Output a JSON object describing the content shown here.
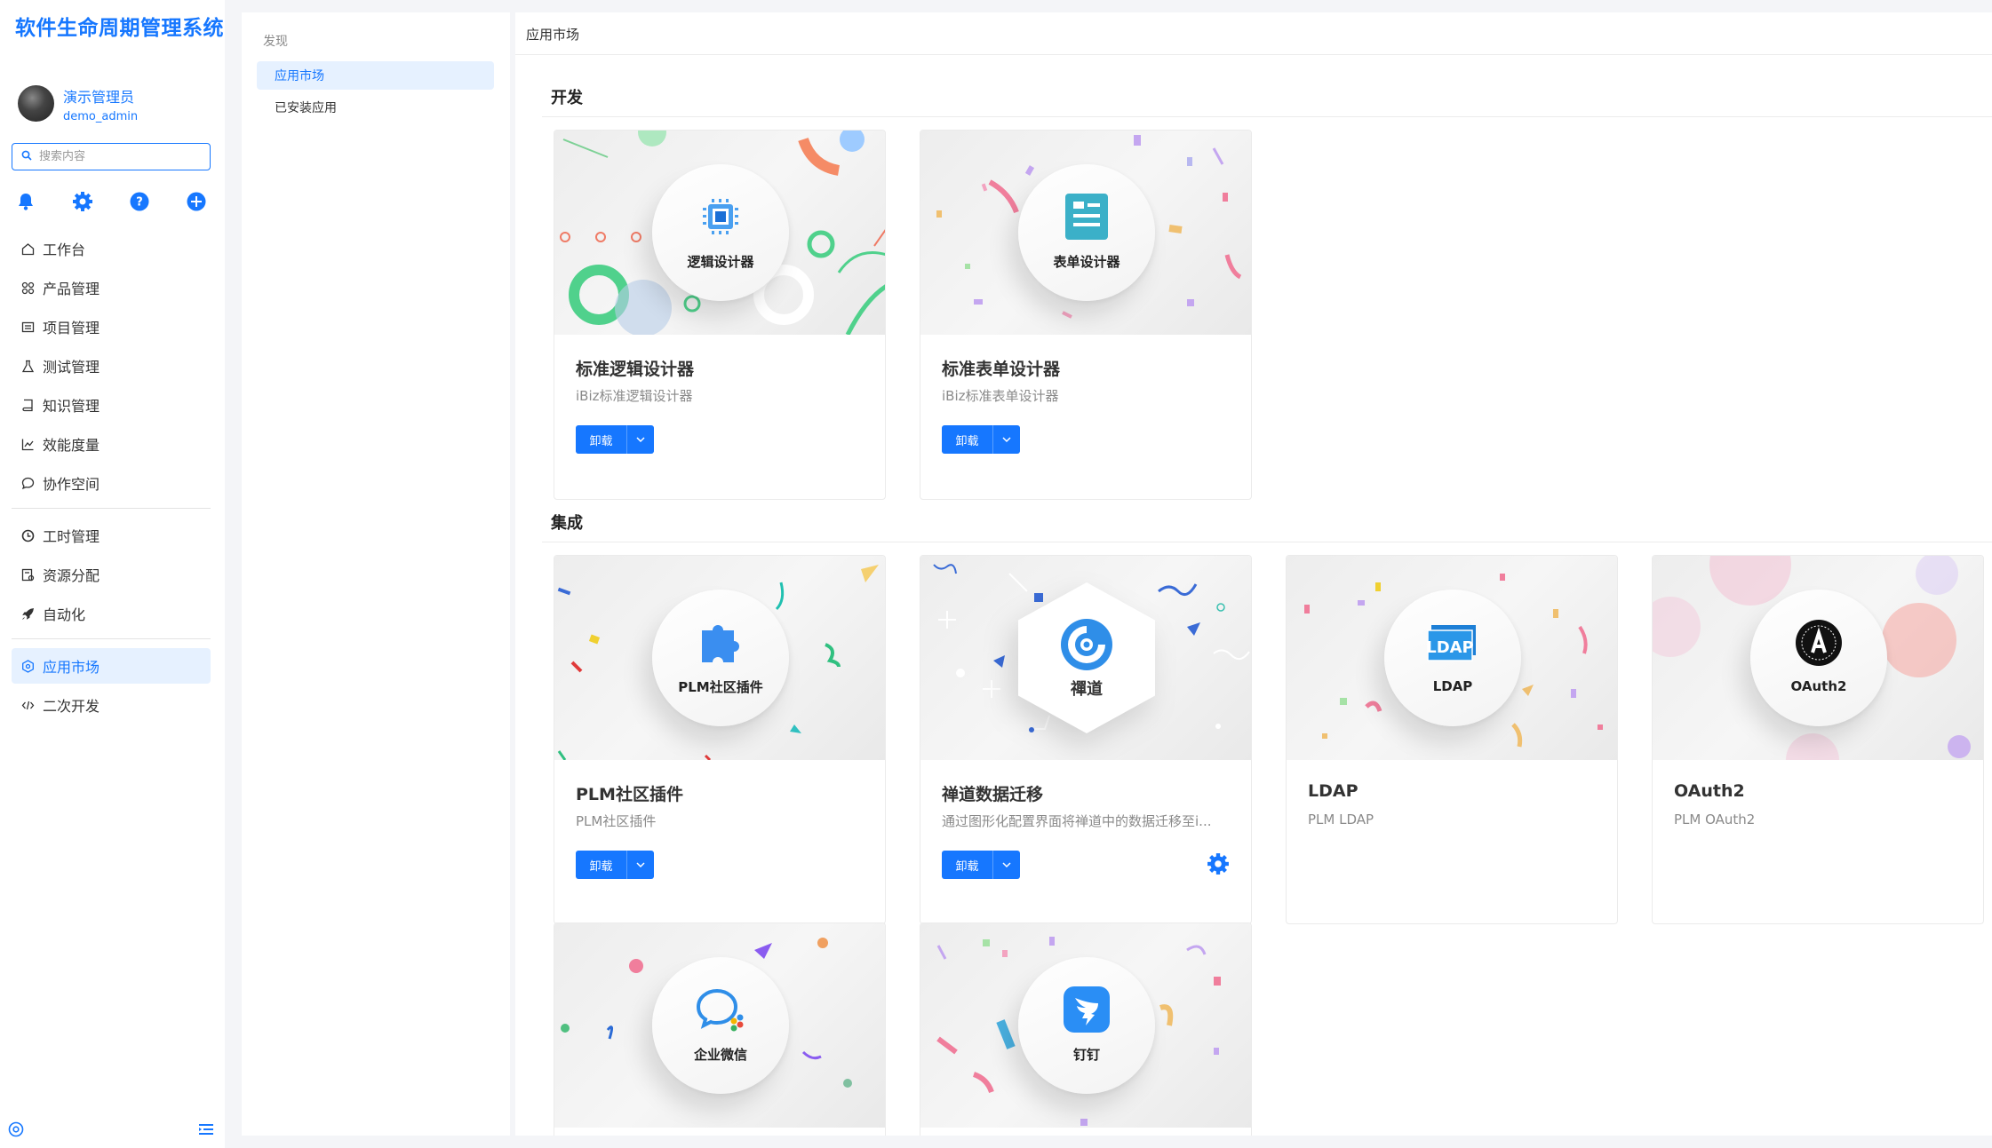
{
  "brand": "软件生命周期管理系统",
  "user": {
    "name": "演示管理员",
    "id": "demo_admin"
  },
  "search": {
    "placeholder": "搜索内容"
  },
  "nav": {
    "workbench": "工作台",
    "product": "产品管理",
    "project": "项目管理",
    "test": "测试管理",
    "knowledge": "知识管理",
    "metrics": "效能度量",
    "collab": "协作空间",
    "worktime": "工时管理",
    "resource": "资源分配",
    "automation": "自动化",
    "market": "应用市场",
    "secondary": "二次开发"
  },
  "panel": {
    "title": "发现",
    "items": [
      "应用市场",
      "已安装应用"
    ]
  },
  "breadcrumb": "应用市场",
  "sections": [
    "开发",
    "集成"
  ],
  "cards": [
    {
      "banner_label": "逻辑设计器",
      "title": "标准逻辑设计器",
      "desc": "iBiz标准逻辑设计器",
      "button": "卸载"
    },
    {
      "banner_label": "表单设计器",
      "title": "标准表单设计器",
      "desc": "iBiz标准表单设计器",
      "button": "卸载"
    },
    {
      "banner_label": "PLM社区插件",
      "title": "PLM社区插件",
      "desc": "PLM社区插件",
      "button": "卸载"
    },
    {
      "banner_label": "禪道",
      "title": "禅道数据迁移",
      "desc": "通过图形化配置界面将禅道中的数据迁移至i...",
      "button": "卸载"
    },
    {
      "banner_label": "LDAP",
      "title": "LDAP",
      "desc": "PLM LDAP",
      "icon_text": "LDAP"
    },
    {
      "banner_label": "OAuth2",
      "title": "OAuth2",
      "desc": "PLM OAuth2"
    },
    {
      "banner_label": "企业微信"
    },
    {
      "banner_label": "钉钉"
    }
  ],
  "colors": {
    "primary": "#1677ff",
    "active_bg": "#e6f1ff",
    "page_bg": "#f4f5f8"
  }
}
